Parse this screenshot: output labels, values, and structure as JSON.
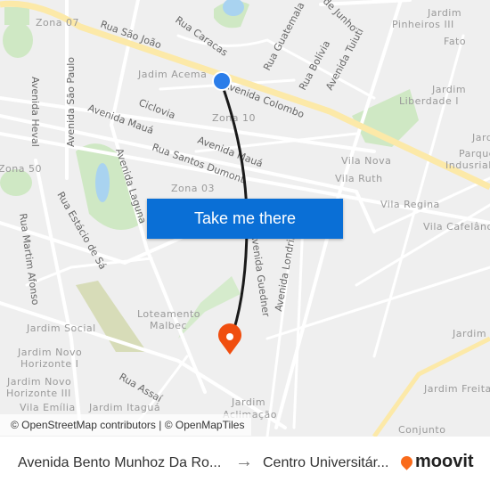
{
  "map": {
    "labels": [
      "Zona 07",
      "Rua São João",
      "Rua Caracas",
      "Rua Guatemala",
      "de Junho",
      "Jardim",
      "Pinheiros III",
      "Fato",
      "Jadim Acema",
      "Avenida Colombo",
      "Rua Bolívia",
      "Avenida Tuiuti",
      "Jardim",
      "Liberdade I",
      "Avenida Heval",
      "Avenida São Paulo",
      "Ciclovia",
      "Avenida Mauá",
      "Zona 10",
      "Avenida Mauá",
      "Rua Santos Dumont",
      "Vila Nova",
      "Jardim",
      "Parque",
      "Indusrial",
      "Vila Ruth",
      "Zona 50",
      "Avenida Laguna",
      "Zona 03",
      "Rua Estácio de Sá",
      "Vila Regina",
      "Vila Cafelândia",
      "Rua Martim Afonso",
      "Avenida Guedner",
      "Avenida Londrina",
      "Loteamento",
      "Malbec",
      "Jardim Social",
      "Jardim Novo",
      "Horizonte I",
      "Jardim Novo",
      "Horizonte III",
      "Rua Assaí",
      "Jardim",
      "Aclimação",
      "Vila Emília",
      "Jardim Freitas",
      "Jardim I",
      "Conjunto",
      "Jardim Itaguá"
    ],
    "origin_color": "#2b7de9",
    "destination_color": "#f04e0f",
    "route_color": "#1a1a1a"
  },
  "cta": {
    "label": "Take me there"
  },
  "attribution": "© OpenStreetMap contributors | © OpenMapTiles",
  "footer": {
    "from": "Avenida Bento Munhoz Da Ro...",
    "arrow": "→",
    "to": "Centro Universitár...",
    "brand": "moovit"
  }
}
